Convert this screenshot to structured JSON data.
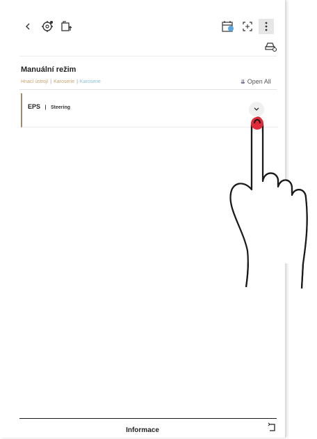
{
  "header": {
    "title": "Manuální režim"
  },
  "breadcrumb": {
    "items": [
      "Hnací ústrojí",
      "Karoserie",
      "Karoserie"
    ]
  },
  "actions": {
    "open_all_label": "Open All"
  },
  "panel": {
    "system": "EPS",
    "separator": "|",
    "name": "Steering"
  },
  "footer": {
    "title": "Informace"
  },
  "icons": {
    "back": "chevron-left-icon",
    "diagnostics": "gear-scan-icon",
    "device": "device-upload-icon",
    "calendar": "calendar-badge-icon",
    "capture": "capture-icon",
    "menu": "more-vertical-icon",
    "car": "car-settings-icon",
    "expand": "chevron-down-icon",
    "exit": "exit-icon"
  },
  "colors": {
    "breadcrumb_done": "#c9a36e",
    "breadcrumb_active": "#88bfd8",
    "panel_border": "#a08a6e",
    "touch_indicator": "#e22b3a"
  }
}
